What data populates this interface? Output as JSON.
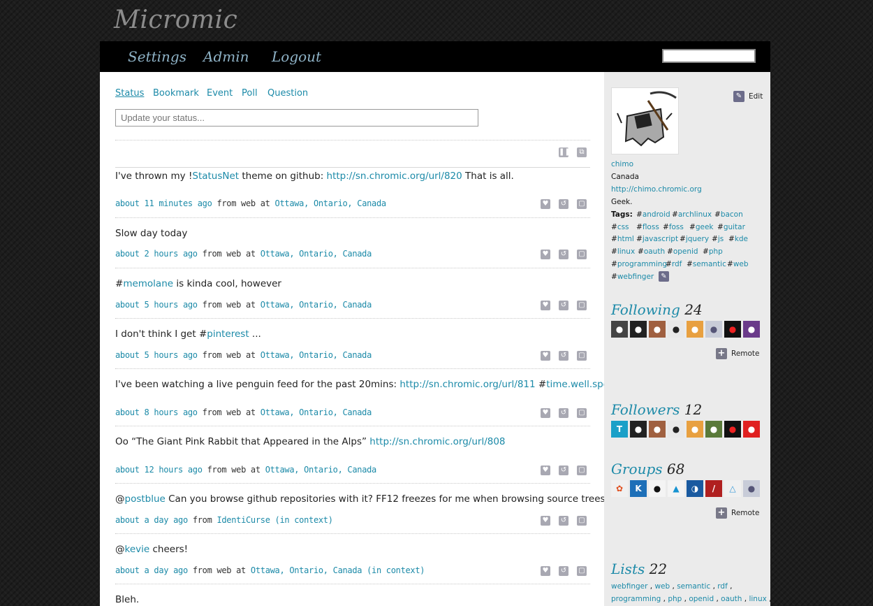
{
  "site": {
    "title": "Micromic"
  },
  "nav": {
    "settings": "Settings",
    "admin": "Admin",
    "logout": "Logout",
    "search_value": ""
  },
  "composer": {
    "tabs": [
      "Status",
      "Bookmark",
      "Event",
      "Poll",
      "Question"
    ],
    "placeholder": "Update your status..."
  },
  "notices": [
    {
      "segments": [
        {
          "t": "I've thrown my !"
        },
        {
          "t": "StatusNet",
          "link": true
        },
        {
          "t": " theme on github: "
        },
        {
          "t": "http://sn.chromic.org/url/820",
          "link": true
        },
        {
          "t": " That is all."
        }
      ],
      "time": "about 11 minutes ago",
      "from": "from web at",
      "location": "Ottawa, Ontario, Canada"
    },
    {
      "segments": [
        {
          "t": "Slow day today"
        }
      ],
      "time": "about 2 hours ago",
      "from": "from web at",
      "location": "Ottawa, Ontario, Canada"
    },
    {
      "segments": [
        {
          "t": "#"
        },
        {
          "t": "memolane",
          "link": true
        },
        {
          "t": " is kinda cool, however"
        }
      ],
      "time": "about 5 hours ago",
      "from": "from web at",
      "location": "Ottawa, Ontario, Canada"
    },
    {
      "segments": [
        {
          "t": "I don't think I get #"
        },
        {
          "t": "pinterest",
          "link": true
        },
        {
          "t": " ..."
        }
      ],
      "time": "about 5 hours ago",
      "from": "from web at",
      "location": "Ottawa, Ontario, Canada"
    },
    {
      "segments": [
        {
          "t": "I've been watching a live penguin feed for the past 20mins: "
        },
        {
          "t": "http://sn.chromic.org/url/811",
          "link": true
        },
        {
          "t": " #"
        },
        {
          "t": "time.well.spent",
          "link": true
        }
      ],
      "time": "about 8 hours ago",
      "from": "from web at",
      "location": "Ottawa, Ontario, Canada"
    },
    {
      "segments": [
        {
          "t": "Oo “The Giant Pink Rabbit that Appeared in the Alps” "
        },
        {
          "t": "http://sn.chromic.org/url/808",
          "link": true
        }
      ],
      "time": "about 12 hours ago",
      "from": "from web at",
      "location": "Ottawa, Ontario, Canada"
    },
    {
      "segments": [
        {
          "t": "@"
        },
        {
          "t": "postblue",
          "link": true
        },
        {
          "t": " Can you browse github repositories with it? FF12 freezes for me when browsing source trees :\\"
        }
      ],
      "time": "about a day ago",
      "from": "from",
      "location": "IdentiCurse (in context)"
    },
    {
      "segments": [
        {
          "t": "@"
        },
        {
          "t": "kevie",
          "link": true
        },
        {
          "t": " cheers!"
        }
      ],
      "time": "about a day ago",
      "from": "from web at",
      "location": "Ottawa, Ontario, Canada (in context)"
    },
    {
      "segments": [
        {
          "t": "Bleh."
        }
      ],
      "time": "",
      "from": "",
      "location": ""
    }
  ],
  "profile": {
    "edit_label": "Edit",
    "nickname": "chimo",
    "location": "Canada",
    "homepage": "http://chimo.chromic.org",
    "bio": "Geek.",
    "tags_label": "Tags:",
    "tags": [
      "android",
      "archlinux",
      "bacon",
      "css",
      "floss",
      "foss",
      "geek",
      "guitar",
      "html",
      "javascript",
      "jquery",
      "js",
      "kde",
      "linux",
      "oauth",
      "openid",
      "php",
      "programming",
      "rdf",
      "semantic",
      "web",
      "webfinger"
    ]
  },
  "following": {
    "title": "Following",
    "count": "24",
    "remote_label": "Remote"
  },
  "followers": {
    "title": "Followers",
    "count": "12"
  },
  "groups": {
    "title": "Groups",
    "count": "68",
    "remote_label": "Remote"
  },
  "lists": {
    "title": "Lists",
    "count": "22",
    "items": [
      "webfinger",
      "web",
      "semantic",
      "rdf",
      "programming",
      "php",
      "openid",
      "oauth",
      "linux"
    ]
  }
}
